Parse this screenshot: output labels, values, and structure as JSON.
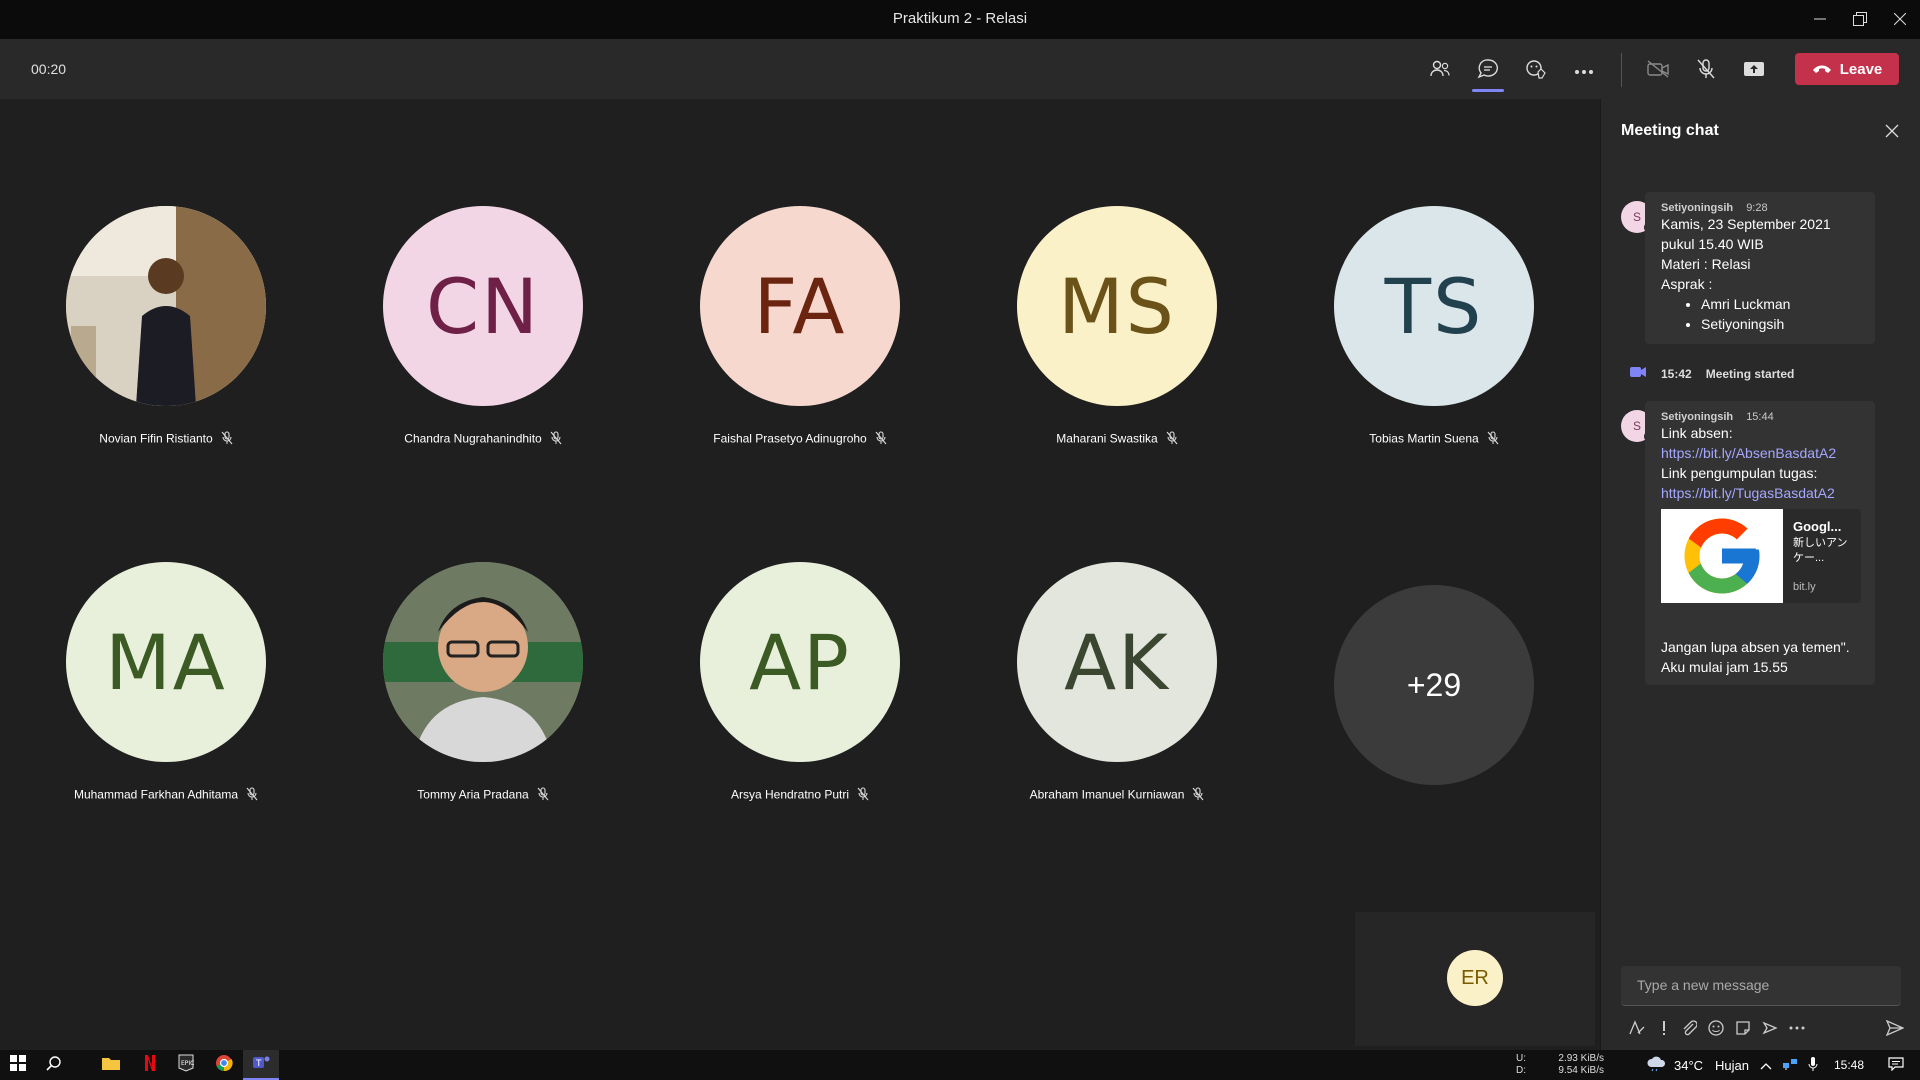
{
  "window": {
    "title": "Praktikum 2 - Relasi"
  },
  "meeting": {
    "timer": "00:20",
    "leave_label": "Leave"
  },
  "participants": [
    {
      "name": "Novian Fifin Ristianto",
      "initials": "",
      "photo": true,
      "bg": "#b6a58c",
      "fg": "#000000"
    },
    {
      "name": "Chandra Nugrahanindhito",
      "initials": "CN",
      "photo": false,
      "bg": "#f3d6e6",
      "fg": "#6e2047"
    },
    {
      "name": "Faishal Prasetyo Adinugroho",
      "initials": "FA",
      "photo": false,
      "bg": "#f6d8cf",
      "fg": "#6b2410"
    },
    {
      "name": "Maharani Swastika",
      "initials": "MS",
      "photo": false,
      "bg": "#fbf1c8",
      "fg": "#6b5218"
    },
    {
      "name": "Tobias Martin Suena",
      "initials": "TS",
      "photo": false,
      "bg": "#dbe6eb",
      "fg": "#22414f"
    },
    {
      "name": "Muhammad Farkhan Adhitama",
      "initials": "MA",
      "photo": false,
      "bg": "#e8f0dc",
      "fg": "#3c5a24"
    },
    {
      "name": "Tommy Aria Pradana",
      "initials": "",
      "photo": true,
      "bg": "#8c9a8a",
      "fg": "#000000"
    },
    {
      "name": "Arsya Hendratno Putri",
      "initials": "AP",
      "photo": false,
      "bg": "#e8f0dc",
      "fg": "#3c5a24"
    },
    {
      "name": "Abraham Imanuel Kurniawan",
      "initials": "AK",
      "photo": false,
      "bg": "#e2e6dc",
      "fg": "#3a4630"
    }
  ],
  "overflow": {
    "label": "+29"
  },
  "self": {
    "initials": "ER"
  },
  "chat": {
    "title": "Meeting chat",
    "message1": {
      "author": "Setiyoningsih",
      "time": "9:28",
      "avatar": "S",
      "lines": [
        "Kamis, 23 September 2021",
        "pukul 15.40 WIB",
        "Materi : Relasi",
        "Asprak :"
      ],
      "bullets": [
        "Amri Luckman",
        "Setiyoningsih"
      ]
    },
    "system": {
      "time": "15:42",
      "text": "Meeting started"
    },
    "message2": {
      "author": "Setiyoningsih",
      "time": "15:44",
      "avatar": "S",
      "line1": "Link absen:",
      "link1": "https://bit.ly/AbsenBasdatA2",
      "line2": "Link pengumpulan tugas:",
      "link2": "https://bit.ly/TugasBasdatA2",
      "card_title": "Googl...",
      "card_desc": "新しいアンケー...",
      "card_site": "bit.ly"
    },
    "message3": {
      "text": "Jangan lupa absen ya temen\". Aku mulai jam 15.55"
    },
    "compose_placeholder": "Type a new message"
  },
  "taskbar": {
    "net_labels": [
      "U:",
      "D:"
    ],
    "net_up": "2.93 KiB/s",
    "net_down": "9.54 KiB/s",
    "temp": "34°C",
    "weather": "Hujan",
    "clock": "15:48"
  }
}
